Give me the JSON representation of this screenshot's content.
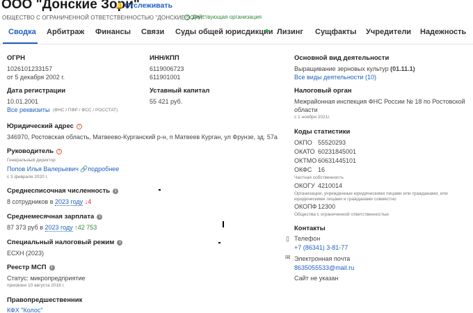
{
  "header": {
    "company_name": "ООО \"Донские Зори\"",
    "track_label": "Отслеживать",
    "subtitle": "ОБЩЕСТВО С ОГРАНИЧЕННОЙ ОТВЕТСТВЕННОСТЬЮ \"ДОНСКИЕ ЗОРИ\"",
    "status": "Действующая организация"
  },
  "tabs": [
    "Сводка",
    "Арбитраж",
    "Финансы",
    "Связи",
    "Суды общей юрисдикции",
    "Лизинг",
    "Сущфакты",
    "Учредители",
    "Надежность"
  ],
  "left": {
    "ogrn_label": "ОГРН",
    "ogrn_value": "1026101233157",
    "ogrn_date": "от 5 декабря 2002 г.",
    "reg_label": "Дата регистрации",
    "reg_value": "10.01.2001",
    "all_req_link": "Все реквизиты",
    "all_req_note": "(ФНС / ПФР / ФСС / РОССТАТ)",
    "address_label": "Юридический адрес",
    "address_value": "346970, Ростовская область, Матвеево-Курганский р-н, п Матвеев Курган, ул Фрунзе, зд. 57а",
    "head_label": "Руководитель",
    "head_role": "Генеральный директор",
    "head_name": "Попов Илья Валерьевич",
    "head_more": "подробнее",
    "head_since": "с 3 февраля 2020 г.",
    "staff_label": "Среднесписочная численность",
    "staff_value": "8 сотрудников в",
    "staff_year": "2023 году",
    "staff_delta": "↓4",
    "salary_label": "Среднемесячная зарплата",
    "salary_value": "87 373 руб в",
    "salary_year": "2023 году",
    "salary_delta": "↑42 753",
    "tax_label": "Специальный налоговый режим",
    "tax_value": "ЕСХН (2023)",
    "msp_label": "Реестр МСП",
    "msp_value": "Статус: микропредприятие",
    "msp_date": "присвоен 10 августа 2018 г.",
    "pred_label": "Правопредшественник",
    "pred_value": "КФХ \"Колос\""
  },
  "middle": {
    "inn_label": "ИНН/КПП",
    "inn_value": "6119006723",
    "kpp_value": "611901001",
    "capital_label": "Уставный капитал",
    "capital_value": "55 421 руб."
  },
  "right": {
    "activity_label": "Основной вид деятельности",
    "activity_value": "Выращивание зерновых культур",
    "activity_code": "(01.11.1)",
    "activity_link": "Все виды деятельности (10)",
    "tax_org_label": "Налоговый орган",
    "tax_org_value1": "Межрайонная инспекция ФНС России № 18 по Ростовской",
    "tax_org_value2": "области",
    "tax_org_since": "с 1 ноября 2021г.",
    "stats_label": "Коды статистики",
    "okpo_k": "ОКПО",
    "okpo_v": "55520293",
    "okato_k": "ОКАТО",
    "okato_v": "60231845001",
    "oktmo_k": "ОКТМО",
    "oktmo_v": "60631445101",
    "okfs_k": "ОКФС",
    "okfs_v": "16",
    "okfs_note": "Частная собственность",
    "okogu_k": "ОКОГУ",
    "okogu_v": "4210014",
    "okogu_note1": "Организации, учрежденные юридическими лицами или гражданами, или",
    "okogu_note2": "юридическими лицами и гражданами совместно",
    "okopf_k": "ОКОПФ",
    "okopf_v": "12300",
    "okopf_note": "Общества с ограниченной ответственностью",
    "contacts_label": "Контакты",
    "phone_label": "Телефон",
    "phone_value": "+7 (86341) 3-81-77",
    "email_label": "Электронная почта",
    "email_value": "8635055533@mail.ru",
    "site_value": "Сайт не указан"
  },
  "icons": {
    "bell": "bell-icon",
    "check": "check-circle-icon",
    "info": "info-icon",
    "warn": "warning-icon",
    "link": "link-icon",
    "phone": "phone-icon",
    "mail": "mail-icon"
  },
  "colors": {
    "accent": "#1f5fbf",
    "active_green": "#2e8b3a",
    "red": "#d9302c",
    "dot_green": "#2db34a"
  }
}
